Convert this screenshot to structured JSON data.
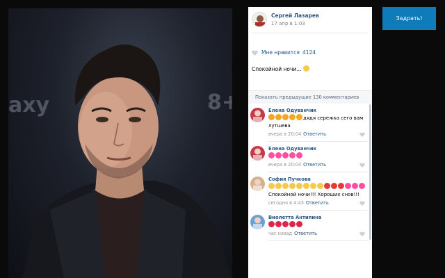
{
  "post": {
    "author": "Сергей Лазарев",
    "date": "17 апр в 1:03",
    "likes_label": "Мне нравится",
    "likes_count": "4124",
    "caption": "Спокойной ночи...",
    "photo_bg_text_left": "axy",
    "photo_bg_text_right": "8+"
  },
  "comments_section": {
    "show_previous": "Показать предыдущие 130 комментариев",
    "reply_label": "Ответить",
    "items": [
      {
        "name": "Елена Одуванчик",
        "text": "дядя сережка сего вам лутшева",
        "time": "вчера в 20:04",
        "emojis": [
          "#f5a623",
          "#f5a623",
          "#f5a623",
          "#f5a623",
          "#f5a623"
        ]
      },
      {
        "name": "Елена Одуванчик",
        "text": "",
        "time": "вчера в 20:04",
        "emojis": [
          "#ff4f9e",
          "#ff4f9e",
          "#ff4f9e",
          "#ff4f9e",
          "#ff4f9e"
        ]
      },
      {
        "name": "София Пучкова",
        "text": "Спокойной ночи!!! Хороших снов!!!",
        "time": "сегодня в 4:43",
        "emojis": [
          "#f7c948",
          "#f7c948",
          "#f7c948",
          "#f7c948",
          "#f7c948",
          "#f7c948",
          "#f7c948",
          "#f7c948",
          "#e53935",
          "#e53935",
          "#e53935",
          "#ff4f9e",
          "#ff4f9e",
          "#ff4f9e"
        ]
      },
      {
        "name": "Виолетта Антипина",
        "text": "",
        "time": "час назад",
        "emojis": [
          "#e0244d",
          "#e0244d",
          "#e0244d",
          "#e0244d",
          "#e0244d"
        ]
      }
    ]
  },
  "ask_button": {
    "label": "Задрать!"
  },
  "colors": {
    "link": "#2a5885",
    "button": "#0f7bb8",
    "meta": "#939393"
  }
}
